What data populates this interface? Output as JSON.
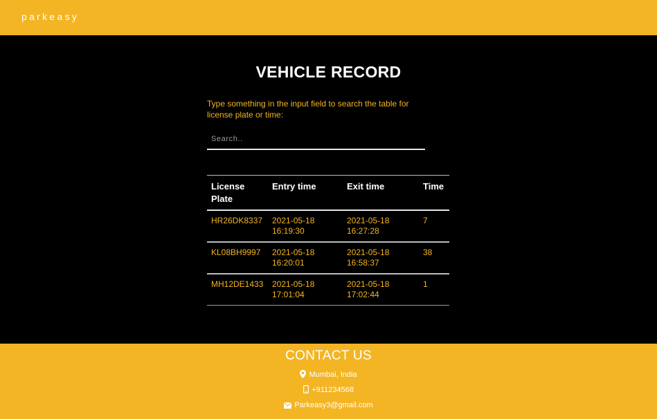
{
  "brand": {
    "name": "parkeasy"
  },
  "page": {
    "title": "VEHICLE RECORD",
    "instructions": "Type something in the input field to search the table for license plate or time:"
  },
  "search": {
    "placeholder": "Search..",
    "value": ""
  },
  "table": {
    "headers": [
      "License Plate",
      "Entry time",
      "Exit time",
      "Time"
    ],
    "rows": [
      {
        "plate": "HR26DK8337",
        "entry": "2021-05-18 16:19:30",
        "exit": "2021-05-18 16:27:28",
        "time": "7"
      },
      {
        "plate": "KL08BH9997",
        "entry": "2021-05-18 16:20:01",
        "exit": "2021-05-18 16:58:37",
        "time": "38"
      },
      {
        "plate": "MH12DE1433",
        "entry": "2021-05-18 17:01:04",
        "exit": "2021-05-18 17:02:44",
        "time": "1"
      }
    ]
  },
  "footer": {
    "title": "CONTACT US",
    "location": {
      "icon": "map-marker-icon",
      "text": "Mumbai, India"
    },
    "phone": {
      "icon": "mobile-phone-icon",
      "text": "+911234568"
    },
    "email": {
      "icon": "envelope-icon",
      "text": "Parkeasy3@gmail.com"
    }
  },
  "colors": {
    "accent": "#f3b523",
    "background": "#000000",
    "text": "#ffffff"
  }
}
